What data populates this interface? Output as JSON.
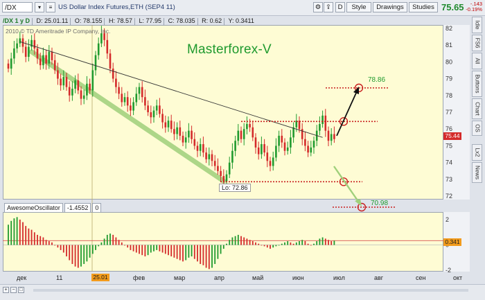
{
  "toolbar": {
    "symbol": "/DX",
    "description": "US Dollar Index Futures,ETH (SEP4 11)",
    "buttons": [
      "Style",
      "Drawings",
      "Studies"
    ],
    "small_buttons": [
      "D"
    ],
    "last_price": "75.65",
    "change": "-.143",
    "change_pct": "-0.19%"
  },
  "infobar": {
    "label": "/DX 1 y D",
    "date": "D: 25.01.11",
    "open": "O: 78.155",
    "high": "H: 78.57",
    "low": "L: 77.95",
    "close": "C: 78.035",
    "range": "R: 0.62",
    "y": "Y: 0.3411"
  },
  "copyright": "2010 © TD Ameritrade IP Company, Inc.",
  "side_tabs": [
    "Idle",
    "FS6",
    "All",
    "Buttons",
    "Chart",
    "OS",
    "Lx2",
    "News"
  ],
  "colors": {
    "panel_bg": "#fefcd4",
    "up": "#1f9a2e",
    "down": "#d42a2a",
    "level": "#c81e1e",
    "trend": "#333333",
    "channel": "#9fd07b"
  },
  "chart_data": [
    {
      "type": "candlestick",
      "title": "Masterforex-V",
      "x_ticks": [
        "дек",
        "11",
        "фев",
        "мар",
        "апр",
        "май",
        "июн",
        "июл",
        "авг",
        "сен",
        "окт"
      ],
      "y_ticks": [
        72,
        73,
        74,
        75,
        76,
        77,
        78,
        79,
        80,
        81,
        82
      ],
      "ylim": [
        71.8,
        82.2
      ],
      "last_price_label": "75.44",
      "lo_label": "Lo: 72.86",
      "levels": [
        {
          "name": "78.86",
          "value": 78.45,
          "show_label": true
        },
        {
          "name": "resistance",
          "value": 76.45,
          "show_label": false
        },
        {
          "name": "support",
          "value": 72.86,
          "show_label": false
        },
        {
          "name": "70.98",
          "value": 70.98,
          "show_label": true
        }
      ],
      "closes": [
        79.6,
        80.2,
        80.8,
        81.1,
        81.4,
        80.9,
        80.3,
        80.9,
        81.3,
        80.8,
        80.2,
        79.8,
        80.4,
        79.9,
        80.6,
        80.1,
        79.5,
        79.0,
        78.6,
        79.1,
        78.5,
        78.0,
        78.4,
        78.9,
        78.3,
        77.8,
        78.0,
        78.7,
        78.3,
        79.5,
        80.4,
        81.1,
        81.7,
        81.3,
        80.5,
        79.6,
        79.0,
        78.5,
        78.1,
        77.6,
        77.9,
        77.4,
        77.1,
        77.6,
        78.1,
        78.5,
        77.9,
        77.4,
        77.0,
        76.7,
        77.1,
        77.4,
        76.9,
        76.4,
        76.1,
        76.5,
        76.0,
        75.7,
        76.1,
        75.6,
        75.2,
        75.5,
        75.9,
        75.4,
        75.0,
        74.7,
        75.1,
        74.6,
        74.2,
        74.5,
        74.1,
        73.8,
        73.5,
        73.2,
        72.9,
        73.3,
        74.0,
        74.7,
        75.3,
        75.9,
        75.4,
        76.0,
        76.3,
        76.1,
        75.5,
        74.9,
        74.5,
        75.1,
        74.6,
        74.1,
        73.8,
        74.3,
        75.0,
        75.6,
        75.2,
        74.7,
        74.9,
        75.5,
        76.1,
        76.5,
        76.0,
        75.4,
        75.0,
        74.6,
        74.9,
        75.3,
        75.9,
        76.3,
        76.8,
        75.9,
        75.3,
        75.7,
        75.4
      ],
      "trendline": {
        "from": [
          4,
          81.2
        ],
        "to": [
          108,
          75.5
        ]
      }
    },
    {
      "type": "bar",
      "title": "AwesomeOscillator",
      "value_label": "-1.4552",
      "secondary_label": "0",
      "last_value_label": "0.341",
      "y_ticks": [
        2,
        0,
        -2
      ],
      "ylim": [
        -2.1,
        2.6
      ],
      "values": [
        1.6,
        1.9,
        2.1,
        2.2,
        2.0,
        1.8,
        1.5,
        1.3,
        1.2,
        1.0,
        0.8,
        0.7,
        0.6,
        0.4,
        0.3,
        0.2,
        0.0,
        -0.2,
        -0.4,
        -0.6,
        -0.9,
        -1.2,
        -1.5,
        -1.7,
        -1.8,
        -1.7,
        -1.5,
        -1.3,
        -1.0,
        -0.7,
        -0.4,
        -0.1,
        0.2,
        0.5,
        0.8,
        0.9,
        0.8,
        0.6,
        0.4,
        0.2,
        0.0,
        -0.2,
        -0.4,
        -0.5,
        -0.6,
        -0.7,
        -0.8,
        -0.9,
        -0.8,
        -0.6,
        -0.5,
        -0.4,
        -0.5,
        -0.6,
        -0.7,
        -0.8,
        -0.9,
        -1.0,
        -1.1,
        -1.2,
        -1.3,
        -1.2,
        -1.0,
        -0.9,
        -1.1,
        -1.3,
        -1.5,
        -1.6,
        -1.8,
        -1.9,
        -1.8,
        -1.5,
        -1.1,
        -0.7,
        -0.3,
        0.1,
        0.4,
        0.6,
        0.7,
        0.8,
        0.7,
        0.6,
        0.5,
        0.4,
        0.3,
        0.2,
        0.1,
        0.0,
        -0.1,
        -0.2,
        -0.3,
        -0.2,
        -0.1,
        0.0,
        0.1,
        0.2,
        0.3,
        0.2,
        0.1,
        0.2,
        0.3,
        0.4,
        0.3,
        0.1,
        0.0,
        0.1,
        0.3,
        0.5,
        0.6,
        0.5,
        0.4,
        0.3,
        0.341
      ]
    }
  ]
}
